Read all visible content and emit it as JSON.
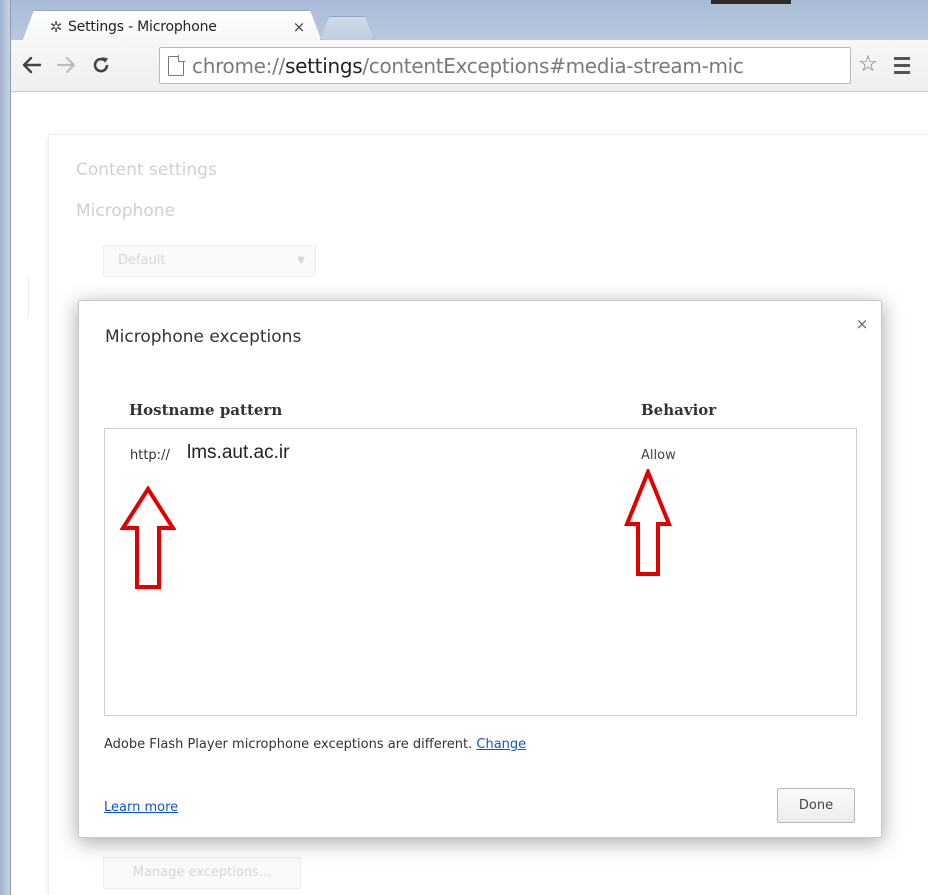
{
  "browser": {
    "tab": {
      "icon": "gear-icon",
      "title": "Settings - Microphone",
      "close_label": "×"
    },
    "toolbar": {
      "url_scheme": "chrome://",
      "url_host": "settings",
      "url_path": "/contentExceptions#media-stream-mic"
    }
  },
  "page": {
    "title": "Content settings",
    "section": "Microphone",
    "select_value": "Default",
    "manage_button": "Manage exceptions..."
  },
  "dialog": {
    "title": "Microphone exceptions",
    "close_label": "×",
    "columns": {
      "host": "Hostname pattern",
      "behavior": "Behavior"
    },
    "exceptions": [
      {
        "scheme": "http://",
        "host": "lms.aut.ac.ir",
        "behavior": "Allow"
      }
    ],
    "flash_note": "Adobe Flash Player microphone exceptions are different.",
    "flash_link": "Change",
    "learn_more": "Learn more",
    "done_label": "Done"
  },
  "colors": {
    "annotation_arrow": "#e00000",
    "link": "#1155cc"
  }
}
